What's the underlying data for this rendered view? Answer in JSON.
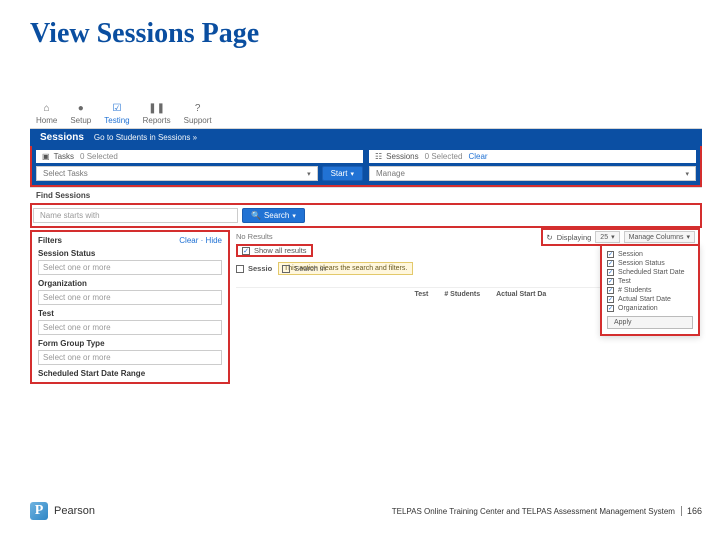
{
  "slide": {
    "title": "View Sessions Page"
  },
  "topnav": {
    "items": [
      {
        "label": "Home",
        "icon": "⌂"
      },
      {
        "label": "Setup",
        "icon": "●"
      },
      {
        "label": "Testing",
        "icon": "☑"
      },
      {
        "label": "Reports",
        "icon": "❚❚"
      },
      {
        "label": "Support",
        "icon": "?"
      }
    ]
  },
  "sessionsBar": {
    "title": "Sessions",
    "link": "Go to Students in Sessions »"
  },
  "tasksPanel": {
    "iconLabel": "Tasks",
    "selected": "0 Selected",
    "select_placeholder": "Select Tasks",
    "start_label": "Start"
  },
  "sessionsPanel": {
    "iconLabel": "Sessions",
    "selected": "0 Selected",
    "clear": "Clear",
    "manage_placeholder": "Manage"
  },
  "find": {
    "title": "Find Sessions",
    "search_placeholder": "Name starts with",
    "search_button": "Search"
  },
  "filters": {
    "title": "Filters",
    "clear": "Clear",
    "hide": "Hide",
    "groups": [
      {
        "label": "Session Status",
        "placeholder": "Select one or more"
      },
      {
        "label": "Organization",
        "placeholder": "Select one or more"
      },
      {
        "label": "Test",
        "placeholder": "Select one or more"
      },
      {
        "label": "Form Group Type",
        "placeholder": "Select one or more"
      },
      {
        "label": "Scheduled Start Date Range",
        "placeholder": ""
      }
    ]
  },
  "results": {
    "no_results": "No Results",
    "show_all": "Show all results",
    "tooltip": "This action clears the search and filters.",
    "sessions_header": "Sessio",
    "search_in": "Search in",
    "columns": [
      "Test",
      "# Students",
      "Actual Start Da"
    ]
  },
  "displaying": {
    "refresh": "↻",
    "label": "Displaying",
    "page_size": "25",
    "manage_columns": "Manage Columns"
  },
  "columnsMenu": {
    "options": [
      "Session",
      "Session Status",
      "Scheduled Start Date",
      "Test",
      "# Students",
      "Actual Start Date",
      "Organization"
    ],
    "apply": "Apply"
  },
  "footer": {
    "brand": "Pearson",
    "text": "TELPAS Online Training Center and TELPAS Assessment Management System",
    "page": "166"
  }
}
